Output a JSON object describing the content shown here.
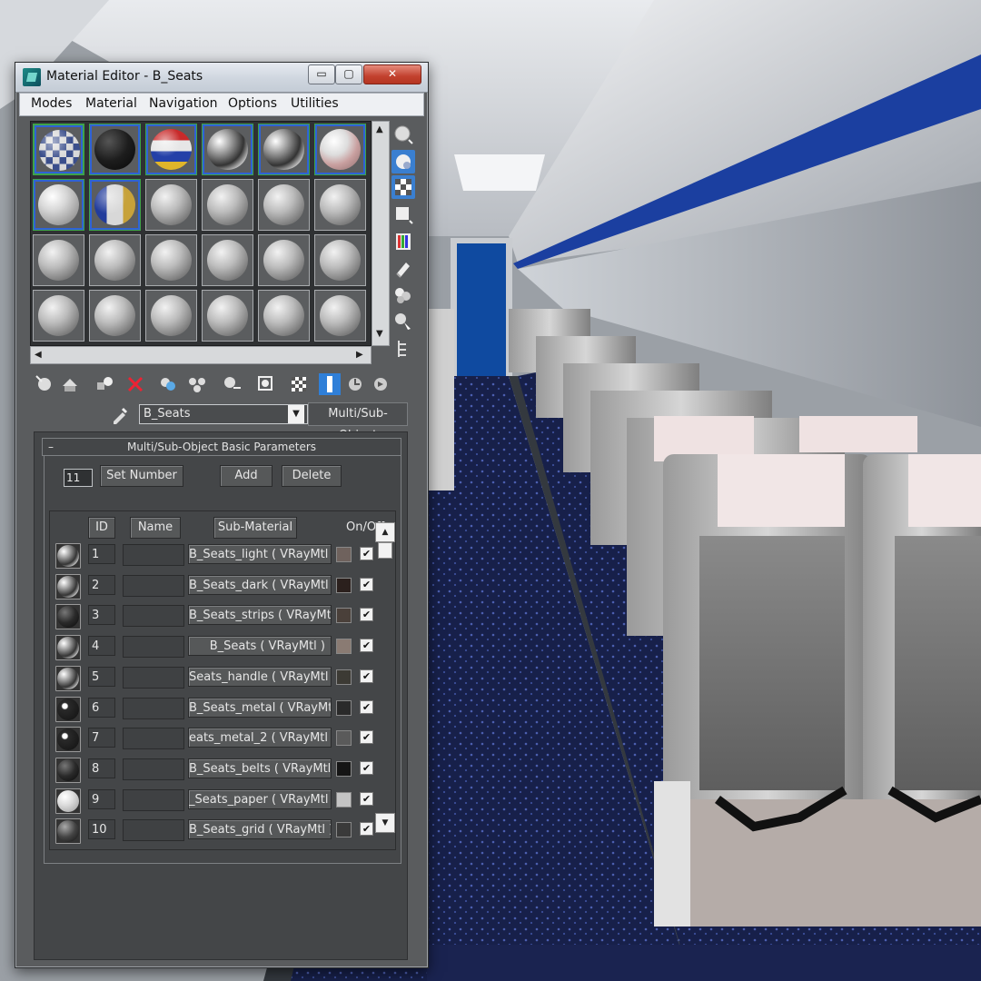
{
  "window": {
    "title": "Material Editor - B_Seats",
    "minimize_glyph": "▭",
    "maximize_glyph": "▢",
    "close_glyph": "✕"
  },
  "menu": [
    "Modes",
    "Material",
    "Navigation",
    "Options",
    "Utilities"
  ],
  "material_name": "B_Seats",
  "material_type": "Multi/Sub-Object",
  "rollout": {
    "collapse_glyph": "–",
    "title": "Multi/Sub-Object Basic Parameters"
  },
  "params": {
    "count": "11",
    "set_number_label": "Set Number",
    "add_label": "Add",
    "delete_label": "Delete"
  },
  "list": {
    "headers": {
      "id": "ID",
      "name": "Name",
      "sub": "Sub-Material",
      "onoff": "On/Off"
    },
    "rows": [
      {
        "id": "1",
        "sub": "B_Seats_light ( VRayMtl )",
        "color": "#6f625d",
        "thumb": "metal",
        "on": "✔"
      },
      {
        "id": "2",
        "sub": "B_Seats_dark ( VRayMtl )",
        "color": "#2b201d",
        "thumb": "metal",
        "on": "✔"
      },
      {
        "id": "3",
        "sub": "B_Seats_strips ( VRayMtl )",
        "color": "#4a403a",
        "thumb": "dark",
        "on": "✔"
      },
      {
        "id": "4",
        "sub": "B_Seats ( VRayMtl )",
        "color": "#8a7b73",
        "thumb": "metal",
        "on": "✔"
      },
      {
        "id": "5",
        "sub": "Seats_handle ( VRayMtl )",
        "color": "#3c3a34",
        "thumb": "metal",
        "on": "✔"
      },
      {
        "id": "6",
        "sub": "B_Seats_metal ( VRayMtl )",
        "color": "#2a2a2a",
        "thumb": "darkspot",
        "on": "✔"
      },
      {
        "id": "7",
        "sub": "eats_metal_2 ( VRayMtl )",
        "color": "#5a5a5a",
        "thumb": "darkspot",
        "on": "✔"
      },
      {
        "id": "8",
        "sub": "B_Seats_belts ( VRayMtl )",
        "color": "#151515",
        "thumb": "dark",
        "on": "✔"
      },
      {
        "id": "9",
        "sub": "_Seats_paper ( VRayMtl )",
        "color": "#c4c4c4",
        "thumb": "light",
        "on": "✔"
      },
      {
        "id": "10",
        "sub": "B_Seats_grid ( VRayMtl )",
        "color": "#3a3a3a",
        "thumb": "grid",
        "on": "✔"
      }
    ]
  },
  "slots": [
    "checker",
    "dark",
    "flag",
    "metal",
    "metal",
    "red",
    "light",
    "grid",
    "plain",
    "plain",
    "plain",
    "plain",
    "plain",
    "plain",
    "plain",
    "plain",
    "plain",
    "plain",
    "plain",
    "plain",
    "plain",
    "plain",
    "plain",
    "plain"
  ],
  "slot_scroll": {
    "up_glyph": "▲",
    "down_glyph": "▼",
    "left_glyph": "◀",
    "right_glyph": "▶"
  },
  "list_scroll": {
    "up_glyph": "▲",
    "down_glyph": "▼"
  },
  "dropdown_arrow": "▼",
  "icons": [
    "sample-type-icon",
    "backlight-icon",
    "background-icon",
    "uv-tiling-icon",
    "video-color-check-icon",
    "make-preview-icon",
    "sample-options-icon",
    "select-by-material-icon",
    "get-material-icon",
    "put-to-scene-icon",
    "assign-to-selection-icon",
    "reset-icon",
    "copy-material-icon",
    "make-unique-icon",
    "put-to-library-icon",
    "material-id-channel-icon",
    "show-map-icon",
    "show-end-result-icon",
    "go-to-parent-icon",
    "go-forward-icon",
    "eyedropper-icon"
  ]
}
